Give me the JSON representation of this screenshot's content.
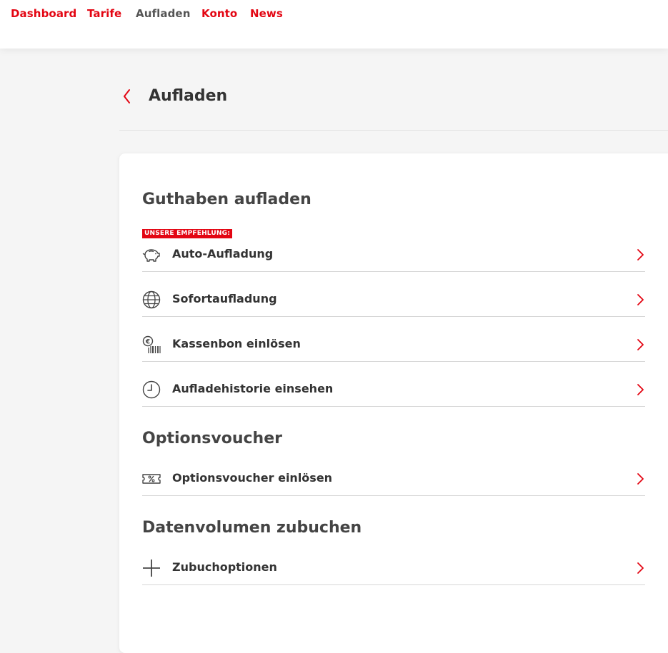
{
  "nav": {
    "items": [
      {
        "label": "Dashboard"
      },
      {
        "label": "Tarife"
      },
      {
        "label": "Aufladen"
      },
      {
        "label": "Konto"
      },
      {
        "label": "News"
      }
    ]
  },
  "header": {
    "title": "Aufladen",
    "back_icon": "chevron-left-icon"
  },
  "colors": {
    "accent": "#e30613",
    "text": "#333333",
    "divider": "#d6d6d6"
  },
  "sections": {
    "guthaben": {
      "title": "Guthaben aufladen",
      "badge": "UNSERE EMPFEHLUNG:",
      "items": [
        {
          "label": "Auto-Aufladung",
          "icon": "piggy-bank-icon"
        },
        {
          "label": "Sofortaufladung",
          "icon": "globe-icon"
        },
        {
          "label": "Kassenbon einlösen",
          "icon": "receipt-euro-icon"
        },
        {
          "label": "Aufladehistorie einsehen",
          "icon": "clock-icon"
        }
      ]
    },
    "optionsvoucher": {
      "title": "Optionsvoucher",
      "items": [
        {
          "label": "Optionsvoucher einlösen",
          "icon": "voucher-percent-icon"
        }
      ]
    },
    "datenvolumen": {
      "title": "Datenvolumen zubuchen",
      "items": [
        {
          "label": "Zubuchoptionen",
          "icon": "plus-icon"
        }
      ]
    }
  }
}
